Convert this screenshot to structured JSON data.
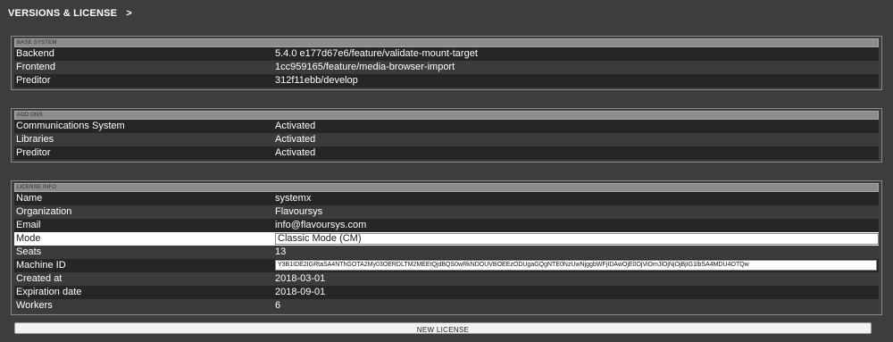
{
  "header": {
    "title": "VERSIONS & LICENSE",
    "chevron": ">"
  },
  "base_system": {
    "title": "BASE SYSTEM",
    "rows": [
      {
        "label": "Backend",
        "value": "5.4.0 e177d67e6/feature/validate-mount-target"
      },
      {
        "label": "Frontend",
        "value": "1cc959165/feature/media-browser-import"
      },
      {
        "label": "Preditor",
        "value": "312f11ebb/develop"
      }
    ]
  },
  "add_ons": {
    "title": "ADD ONS",
    "rows": [
      {
        "label": "Communications System",
        "value": "Activated"
      },
      {
        "label": "Libraries",
        "value": "Activated"
      },
      {
        "label": "Preditor",
        "value": "Activated"
      }
    ]
  },
  "license_info": {
    "title": "LICENSE INFO",
    "name": {
      "label": "Name",
      "value": "systemx"
    },
    "organization": {
      "label": "Organization",
      "value": "Flavoursys"
    },
    "email": {
      "label": "Email",
      "value": "info@flavoursys.com"
    },
    "mode": {
      "label": "Mode",
      "value": "Classic Mode (CM)"
    },
    "seats": {
      "label": "Seats",
      "value": "13"
    },
    "machine_id": {
      "label": "Machine ID",
      "value": "Y3B1IDE2IGRtaSA4NThGOTA2My03OERDLTM2MEEtQjdBQS0wRkNDOUVBOEEzODUgaGQgNTE0NzUwNjggbWFjIDAwOjE0OjViOmJlOjNjOjBjIG1lbSA4MDU4OTQw"
    },
    "created_at": {
      "label": "Created at",
      "value": "2018-03-01"
    },
    "expiration_date": {
      "label": "Expiration date",
      "value": "2018-09-01"
    },
    "workers": {
      "label": "Workers",
      "value": "6"
    }
  },
  "new_license_button": "NEW LICENSE"
}
